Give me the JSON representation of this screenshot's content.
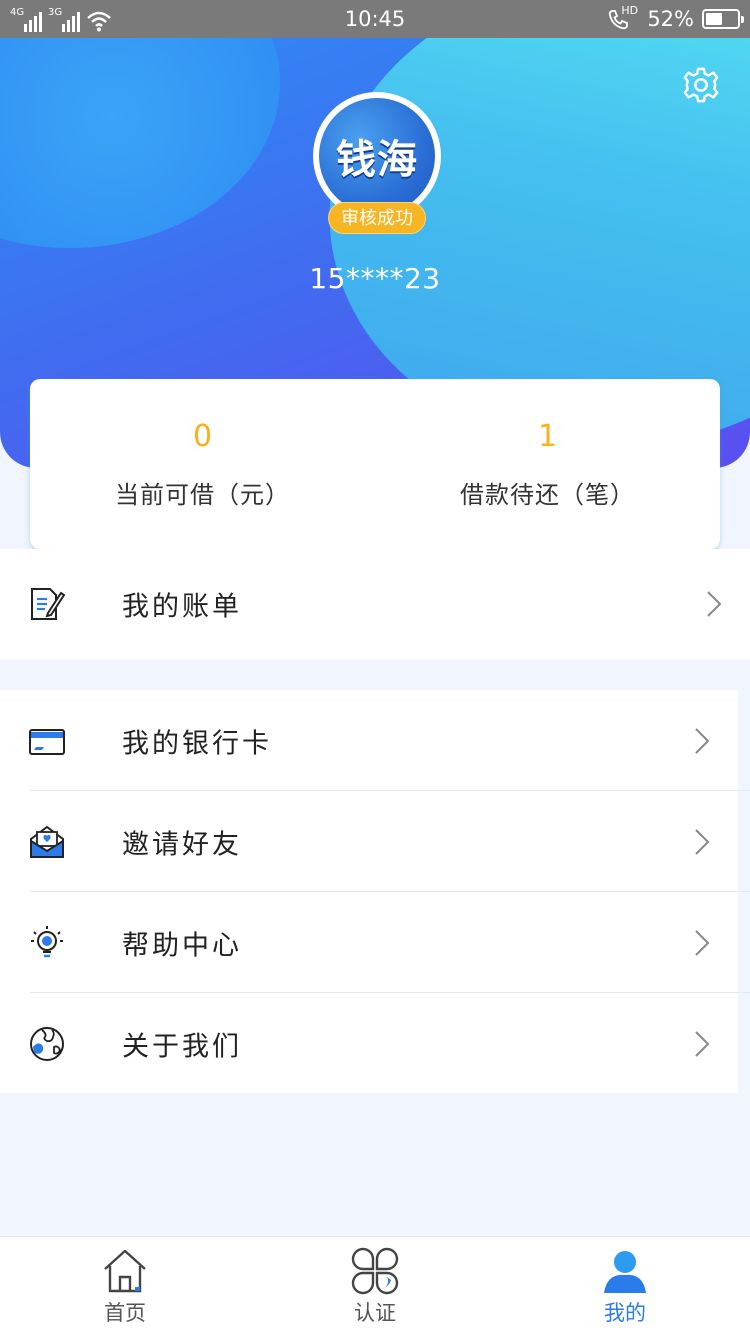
{
  "status_bar": {
    "network_1": "4G",
    "network_2": "3G",
    "time": "10:45",
    "hd_label": "HD",
    "battery_text": "52%",
    "battery_level": 0.52
  },
  "header": {
    "avatar_text": "钱海",
    "badge": "审核成功",
    "phone": "15****23",
    "settings_icon": "gear-icon"
  },
  "stats": [
    {
      "value": "0",
      "label": "当前可借（元）"
    },
    {
      "value": "1",
      "label": "借款待还（笔）"
    }
  ],
  "menu": {
    "bills": {
      "label": "我的账单",
      "icon": "bill-edit-icon"
    },
    "items": [
      {
        "label": "我的银行卡",
        "icon": "bank-card-icon"
      },
      {
        "label": "邀请好友",
        "icon": "invite-envelope-icon"
      },
      {
        "label": "帮助中心",
        "icon": "lightbulb-icon"
      },
      {
        "label": "关于我们",
        "icon": "globe-icon"
      }
    ]
  },
  "tabbar": [
    {
      "label": "首页",
      "icon": "home-icon",
      "active": false
    },
    {
      "label": "认证",
      "icon": "clover-icon",
      "active": false
    },
    {
      "label": "我的",
      "icon": "user-icon",
      "active": true
    }
  ],
  "colors": {
    "accent": "#2b7bea",
    "number": "#f5b21a",
    "badge": "#f6b623"
  }
}
